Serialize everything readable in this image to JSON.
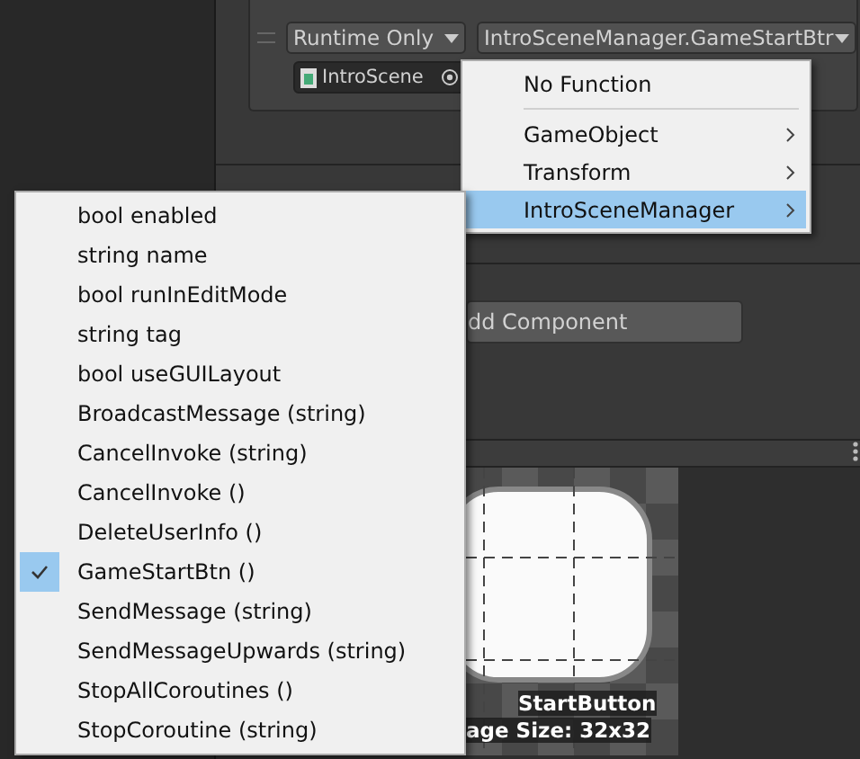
{
  "event": {
    "runtime_dropdown": "Runtime Only",
    "function_dropdown": "IntroSceneManager.GameStartBtr",
    "object_field": "IntroScene"
  },
  "add_component": "dd Component",
  "preview": {
    "name": "StartButton",
    "size": "age Size: 32x32"
  },
  "function_menu": [
    {
      "kind": "item",
      "label": "No Function",
      "selected": false,
      "submenu": false
    },
    {
      "kind": "separator"
    },
    {
      "kind": "item",
      "label": "GameObject",
      "selected": false,
      "submenu": true
    },
    {
      "kind": "item",
      "label": "Transform",
      "selected": false,
      "submenu": true
    },
    {
      "kind": "item",
      "label": "IntroSceneManager",
      "selected": true,
      "submenu": true
    }
  ],
  "member_menu": [
    {
      "label": "bool enabled",
      "checked": false
    },
    {
      "label": "string name",
      "checked": false
    },
    {
      "label": "bool runInEditMode",
      "checked": false
    },
    {
      "label": "string tag",
      "checked": false
    },
    {
      "label": "bool useGUILayout",
      "checked": false
    },
    {
      "label": "BroadcastMessage (string)",
      "checked": false
    },
    {
      "label": "CancelInvoke (string)",
      "checked": false
    },
    {
      "label": "CancelInvoke ()",
      "checked": false
    },
    {
      "label": "DeleteUserInfo ()",
      "checked": false
    },
    {
      "label": "GameStartBtn ()",
      "checked": true
    },
    {
      "label": "SendMessage (string)",
      "checked": false
    },
    {
      "label": "SendMessageUpwards (string)",
      "checked": false
    },
    {
      "label": "StopAllCoroutines ()",
      "checked": false
    },
    {
      "label": "StopCoroutine (string)",
      "checked": false
    }
  ]
}
